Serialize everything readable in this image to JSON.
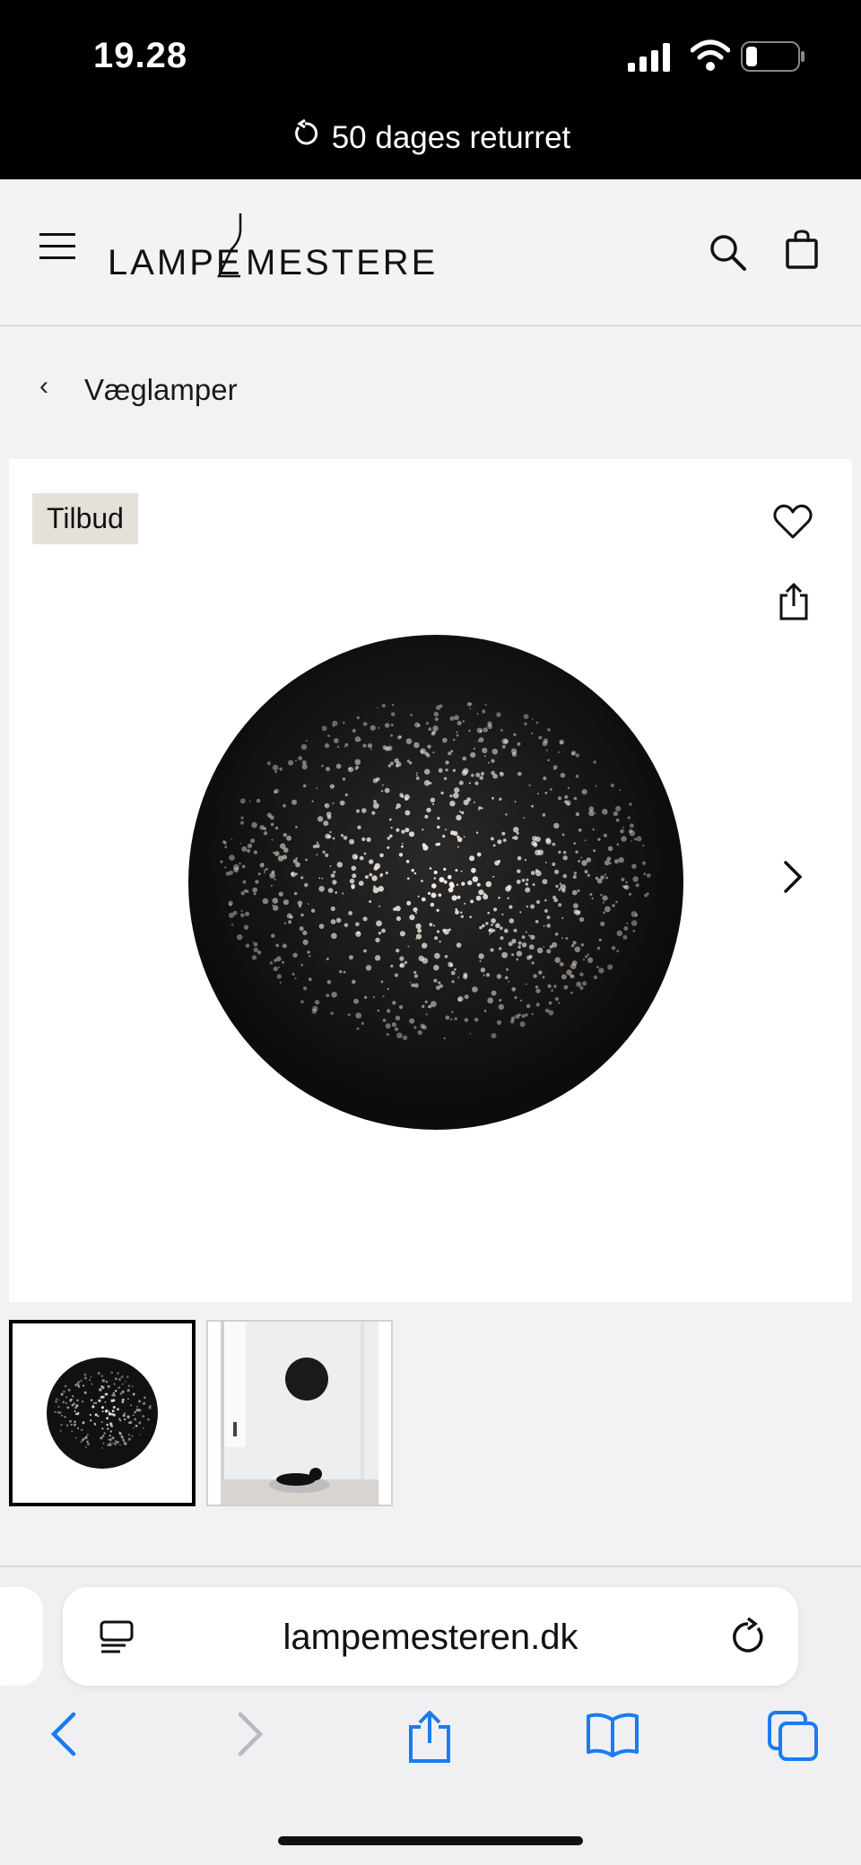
{
  "status": {
    "time": "19.28"
  },
  "announcement": {
    "text": "50 dages returret"
  },
  "header": {
    "logo_text": "LAMPE MESTEREN"
  },
  "breadcrumb": {
    "back": "‹",
    "label": "Væglamper"
  },
  "product": {
    "badge": "Tilbud",
    "image_count": 2,
    "selected_image": 1
  },
  "browser": {
    "url": "lampemesteren.dk"
  },
  "colors": {
    "accent": "#1a7cf0",
    "badge_bg": "#e4e1d9",
    "topbar": "#000000"
  },
  "icons": [
    "menu-icon",
    "search-icon",
    "bag-icon",
    "heart-icon",
    "share-icon",
    "chevron-right-icon",
    "reader-icon",
    "reload-icon",
    "back-icon",
    "forward-icon",
    "bookmarks-icon",
    "tabs-icon"
  ]
}
